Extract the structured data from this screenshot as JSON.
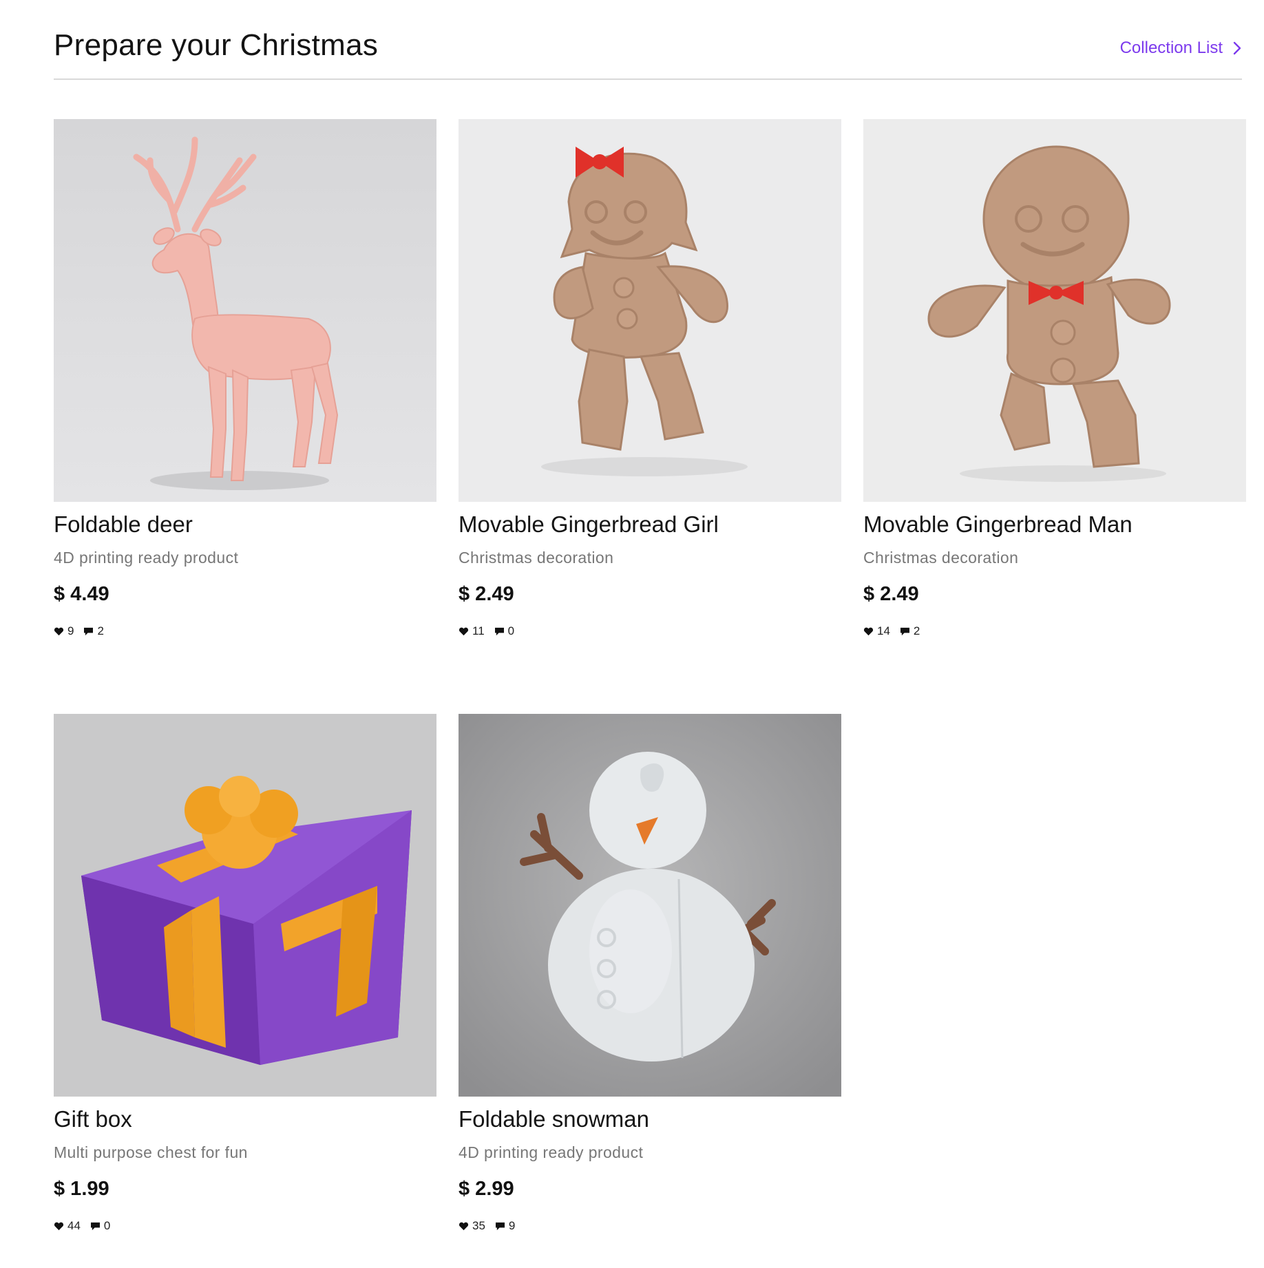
{
  "section": {
    "title": "Prepare your Christmas",
    "collection_link": "Collection List"
  },
  "colors": {
    "accent": "#7c3aed",
    "text": "#141414",
    "muted": "#777777",
    "divider": "#d9d9d9"
  },
  "products": [
    {
      "name": "Foldable deer",
      "desc": "4D printing ready product",
      "price": "$ 4.49",
      "likes": "9",
      "comments": "2",
      "image": "pink-deer-figurine"
    },
    {
      "name": "Movable Gingerbread Girl",
      "desc": "Christmas decoration",
      "price": "$ 2.49",
      "likes": "11",
      "comments": "0",
      "image": "gingerbread-girl-figurine"
    },
    {
      "name": "Movable Gingerbread Man",
      "desc": "Christmas decoration",
      "price": "$ 2.49",
      "likes": "14",
      "comments": "2",
      "image": "gingerbread-man-figurine"
    },
    {
      "name": "Gift box",
      "desc": "Multi purpose chest for fun",
      "price": "$ 1.99",
      "likes": "44",
      "comments": "0",
      "image": "purple-gift-box"
    },
    {
      "name": "Foldable snowman",
      "desc": "4D printing ready product",
      "price": "$ 2.99",
      "likes": "35",
      "comments": "9",
      "image": "white-snowman-figurine"
    }
  ],
  "icons": {
    "likes": "heart-icon",
    "comments": "comment-icon",
    "link_arrow": "chevron-right-icon"
  }
}
